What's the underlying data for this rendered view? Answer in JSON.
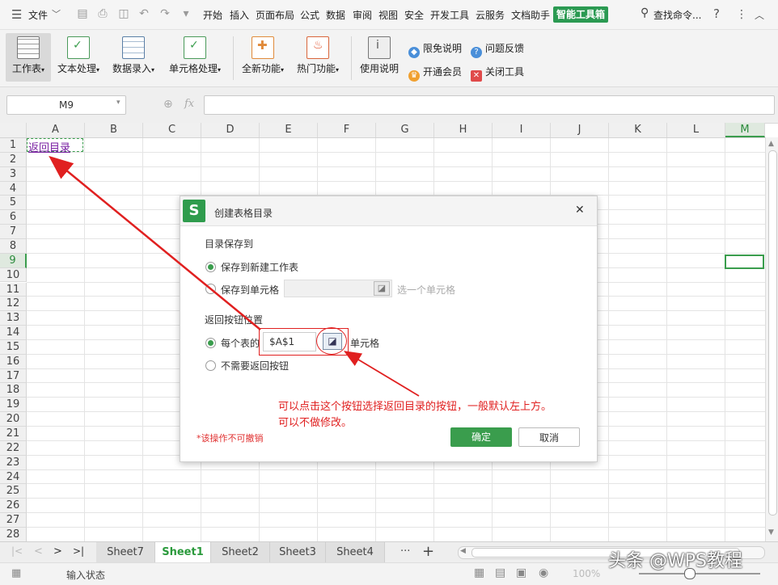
{
  "menubar": {
    "file_label": "文件",
    "tabs": [
      "开始",
      "插入",
      "页面布局",
      "公式",
      "数据",
      "审阅",
      "视图",
      "安全",
      "开发工具",
      "云服务",
      "文档助手"
    ],
    "active_tab": "智能工具箱",
    "search_label": "查找命令...",
    "help": "?",
    "more": "⋮",
    "collapse": "︿"
  },
  "ribbon": {
    "buttons": [
      "工作表",
      "文本处理",
      "数据录入",
      "单元格处理",
      "全新功能",
      "热门功能",
      "使用说明"
    ],
    "links": [
      "限免说明",
      "问题反馈",
      "开通会员",
      "关闭工具"
    ]
  },
  "formula_bar": {
    "name_box": "M9",
    "fx": "fx",
    "zoom_icon": "⊕"
  },
  "grid": {
    "columns": [
      "A",
      "B",
      "C",
      "D",
      "E",
      "F",
      "G",
      "H",
      "I",
      "J",
      "K",
      "L",
      "M"
    ],
    "rows": [
      "1",
      "2",
      "3",
      "4",
      "5",
      "6",
      "7",
      "8",
      "9",
      "10",
      "11",
      "12",
      "13",
      "14",
      "15",
      "16",
      "17",
      "18",
      "19",
      "20",
      "21",
      "22",
      "23",
      "24",
      "25",
      "26",
      "27",
      "28"
    ],
    "cell_a1": "返回目录",
    "selected_cell": "M9"
  },
  "sheets": {
    "tabs": [
      "Sheet7",
      "Sheet1",
      "Sheet2",
      "Sheet3",
      "Sheet4"
    ],
    "active": "Sheet1",
    "nav": [
      "|<",
      "<",
      ">",
      ">|"
    ],
    "more": "···",
    "add": "+"
  },
  "status": {
    "mode": "输入状态",
    "zoom": "100%"
  },
  "watermark": "头条 @WPS教程",
  "dialog": {
    "logo": "S",
    "title": "创建表格目录",
    "close": "✕",
    "section1_label": "目录保存到",
    "option_new_sheet": "保存到新建工作表",
    "option_cell": "保存到单元格",
    "cell_placeholder": "选一个单元格",
    "section2_label": "返回按钮位置",
    "option_each_sheet": "每个表的",
    "cell_ref_value": "$A$1",
    "cell_suffix": "单元格",
    "option_no_button": "不需要返回按钮",
    "warning": "*该操作不可撤销",
    "ok": "确定",
    "cancel": "取消"
  },
  "annotation": {
    "line1": "可以点击这个按钮选择返回目录的按钮，一般默认左上方。",
    "line2": "可以不做修改。",
    "color": "#e02020"
  }
}
